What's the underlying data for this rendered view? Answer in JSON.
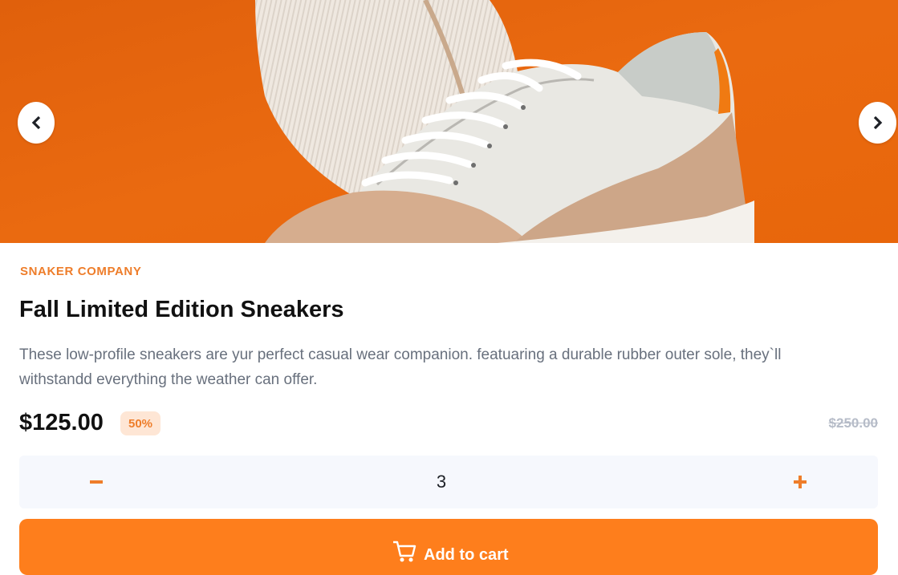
{
  "gallery": {
    "image_alt": "sneaker product photo",
    "prev_icon": "chevron-left-icon",
    "next_icon": "chevron-right-icon"
  },
  "product": {
    "company": "SNAKER COMPANY",
    "title": "Fall Limited Edition Sneakers",
    "description": "These low-profile sneakers are yur perfect casual wear companion. featuaring a durable rubber outer sole, they`ll withstandd everything the weather can offer.",
    "price": "$125.00",
    "discount": "50%",
    "original_price": "$250.00"
  },
  "quantity": {
    "value": "3",
    "minus_icon": "minus-icon",
    "plus_icon": "plus-icon"
  },
  "cart": {
    "label": "Add to cart",
    "icon": "cart-icon"
  },
  "colors": {
    "accent": "#fe7e1c",
    "accent_text": "#ee7d2a",
    "accent_pale": "#fee6d5",
    "dark": "#111111",
    "muted": "#68707d",
    "light_bg": "#f6f8fd"
  }
}
